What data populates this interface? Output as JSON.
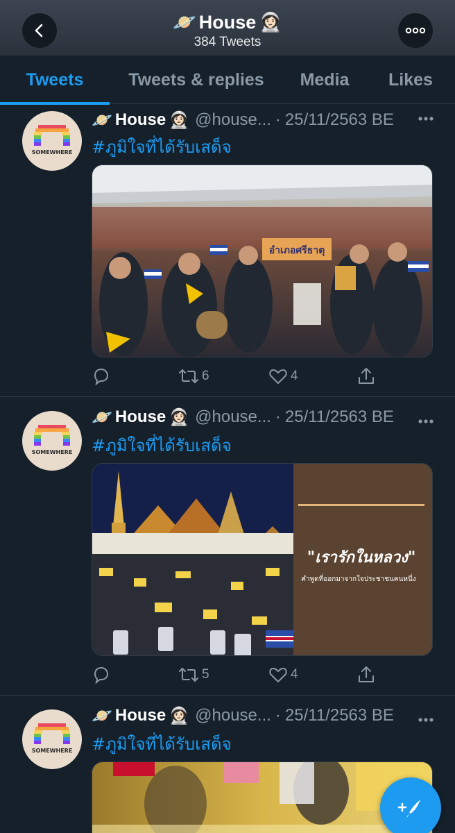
{
  "header": {
    "name": "House",
    "tweet_count": "384 Tweets",
    "emoji_planet": "🪐",
    "emoji_astronaut": "👩🏻‍🚀"
  },
  "tabs": [
    {
      "label": "Tweets",
      "active": true
    },
    {
      "label": "Tweets & replies",
      "active": false
    },
    {
      "label": "Media",
      "active": false
    },
    {
      "label": "Likes",
      "active": false
    }
  ],
  "tweets": [
    {
      "name": "House",
      "handle": "@house...",
      "sep": "·",
      "date": "25/11/2563 BE",
      "text": "#ภูมิใจที่ได้รับเสด็จ",
      "image_sign": "อำเภอศรีธาตุ",
      "retweets": "6",
      "likes": "4"
    },
    {
      "name": "House",
      "handle": "@house...",
      "sep": "·",
      "date": "25/11/2563 BE",
      "text": "#ภูมิใจที่ได้รับเสด็จ",
      "quote": "\"เรารักในหลวง\"",
      "quote_sub": "คำพูดที่ออกมาจากใจประชาชนคนหนึ่ง",
      "retweets": "5",
      "likes": "4"
    },
    {
      "name": "House",
      "handle": "@house...",
      "sep": "·",
      "date": "25/11/2563 BE",
      "text": "#ภูมิใจที่ได้รับเสด็จ"
    }
  ],
  "avatar_text": "SOMEWHERE",
  "colors": {
    "accent": "#1d9bf0",
    "background": "#15202b",
    "muted": "#8b98a5"
  }
}
